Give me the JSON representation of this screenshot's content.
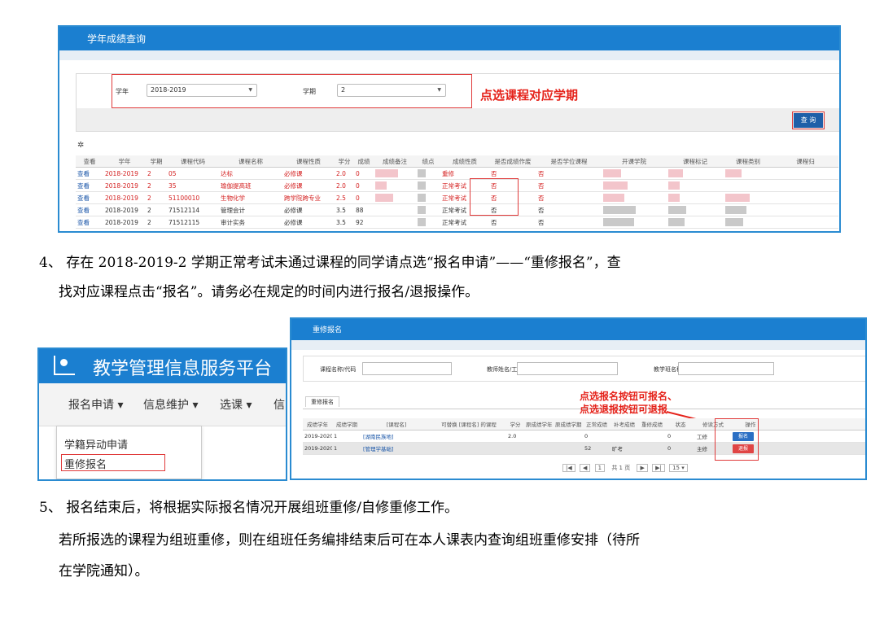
{
  "grade_query": {
    "title": "学年成绩查询",
    "form": {
      "year_label": "学年",
      "year_value": "2018-2019",
      "term_label": "学期",
      "term_value": "2"
    },
    "note": "点选课程对应学期",
    "query_button": "查 询",
    "gear_icon": "gear-icon",
    "columns": [
      "查看",
      "学年",
      "学期",
      "课程代码",
      "课程名称",
      "课程性质",
      "学分",
      "成绩",
      "成绩备注",
      "绩点",
      "成绩性质",
      "是否成绩作废",
      "是否学位课程",
      "开课学院",
      "课程标记",
      "课程类别",
      "课程归"
    ],
    "rows": [
      {
        "view": "查看",
        "year": "2018-2019",
        "term": "2",
        "code": "05",
        "name": "达标",
        "nature": "必修课",
        "credit": "2.0",
        "score": "0",
        "exam": "重修",
        "void": "否",
        "degree": "否"
      },
      {
        "view": "查看",
        "year": "2018-2019",
        "term": "2",
        "code": "35",
        "name": "瑜伽提高班",
        "nature": "必修课",
        "credit": "2.0",
        "score": "0",
        "exam": "正常考试",
        "void": "否",
        "degree": "否"
      },
      {
        "view": "查看",
        "year": "2018-2019",
        "term": "2",
        "code": "51100010",
        "name": "生物化学",
        "nature": "跨学院跨专业",
        "credit": "2.5",
        "score": "0",
        "exam": "正常考试",
        "void": "否",
        "degree": "否"
      },
      {
        "view": "查看",
        "year": "2018-2019",
        "term": "2",
        "code": "71512114",
        "name": "管理会计",
        "nature": "必修课",
        "credit": "3.5",
        "score": "88",
        "exam": "正常考试",
        "void": "否",
        "degree": "否"
      },
      {
        "view": "查看",
        "year": "2018-2019",
        "term": "2",
        "code": "71512115",
        "name": "审计实务",
        "nature": "必修课",
        "credit": "3.5",
        "score": "92",
        "exam": "正常考试",
        "void": "否",
        "degree": "否"
      }
    ]
  },
  "step4": {
    "line1": "4、  存在 2018-2019-2 学期正常考试未通过课程的同学请点选“报名申请”——“重修报名”，查",
    "line2": "找对应课程点击“报名”。请务必在规定的时间内进行报名/退报操作。"
  },
  "platform": {
    "brand": "教学管理信息服务平台",
    "logo_icon": "user-monitor-icon",
    "menu": [
      "报名申请 ▾",
      "信息维护 ▾",
      "选课 ▾",
      "信"
    ],
    "dropdown": [
      "学籍异动申请",
      "重修报名"
    ]
  },
  "retake": {
    "title": "重修报名",
    "search": {
      "course_label": "课程名称/代码",
      "teacher_label": "教师姓名/工号",
      "class_label": "教学班名称"
    },
    "tab": "重修报名",
    "note_line1": "点选报名按钮可报名、",
    "note_line2": "点选退报按钮可退报",
    "columns": [
      "成绩学年",
      "成绩学期",
      "[课程名]",
      "可替换 [课程名] 的课程",
      "学分",
      "原成绩学年",
      "原成绩学期",
      "正常成绩",
      "补考成绩",
      "重修成绩",
      "状态",
      "修读方式",
      "操作"
    ],
    "rows": [
      {
        "year": "2019-2020",
        "term": "1",
        "course": "[湖南民族地]",
        "credit": "2.0",
        "normal": "0",
        "makeup": "",
        "retake": "",
        "status": "0",
        "mode": "工修",
        "action": "报名"
      },
      {
        "year": "2019-2020",
        "term": "1",
        "course": "[管理学基础]",
        "credit": "",
        "normal": "52",
        "makeup": "旷考",
        "retake": "",
        "status": "0",
        "mode": "主修",
        "action": "退报"
      }
    ],
    "pager": {
      "first": "|◀",
      "prev": "◀",
      "page": "1",
      "total": "共 1 页",
      "next": "▶",
      "last": "▶|",
      "size": "15 ▾"
    }
  },
  "step5": {
    "line1": "5、  报名结束后，将根据实际报名情况开展组班重修/自修重修工作。",
    "line2": "若所报选的课程为组班重修，则在组班任务编排结束后可在本人课表内查询组班重修安排（待所",
    "line3": "在学院通知）。"
  }
}
